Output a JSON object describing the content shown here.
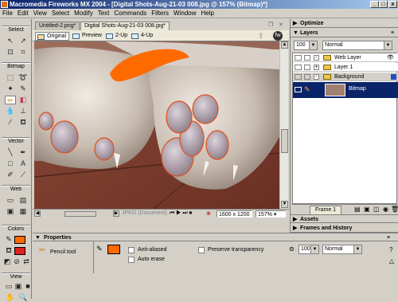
{
  "window": {
    "title": "Macromedia Fireworks MX 2004 - [Digital Shots-Aug-21-03 008.jpg @ 157% (Bitmap)*]"
  },
  "menu": [
    "File",
    "Edit",
    "View",
    "Select",
    "Modify",
    "Text",
    "Commands",
    "Filters",
    "Window",
    "Help"
  ],
  "tools": {
    "sections": {
      "select": "Select",
      "bitmap": "Bitmap",
      "vector": "Vector",
      "web": "Web",
      "colors": "Colors",
      "view": "View"
    }
  },
  "doc_tabs": [
    "Untitled-2.png*",
    "Digital Shots-Aug-21-03 008.jpg*"
  ],
  "view_tabs": [
    "Original",
    "Preview",
    "2-Up",
    "4-Up"
  ],
  "status": {
    "file_type": "JPEG (Document)",
    "size": "1600 x 1200",
    "zoom": "157%"
  },
  "panels": {
    "optimize": "Optimize",
    "layers": "Layers",
    "opacity": "100",
    "blend": "Normal",
    "layer_items": [
      "Web Layer",
      "Layer 1",
      "Background"
    ],
    "bitmap_label": "Bitmap",
    "frame": "Frame 1",
    "assets": "Assets",
    "frames_history": "Frames and History"
  },
  "properties": {
    "title": "Properties",
    "tool_name": "Pencil tool",
    "anti_aliased": "Anti-aliased",
    "auto_erase": "Auto erase",
    "preserve_transparency": "Preserve transparency",
    "opacity": "100",
    "blend": "Normal"
  },
  "colors": {
    "accent_orange": "#ff6a00",
    "stroke_red": "#e05020"
  }
}
